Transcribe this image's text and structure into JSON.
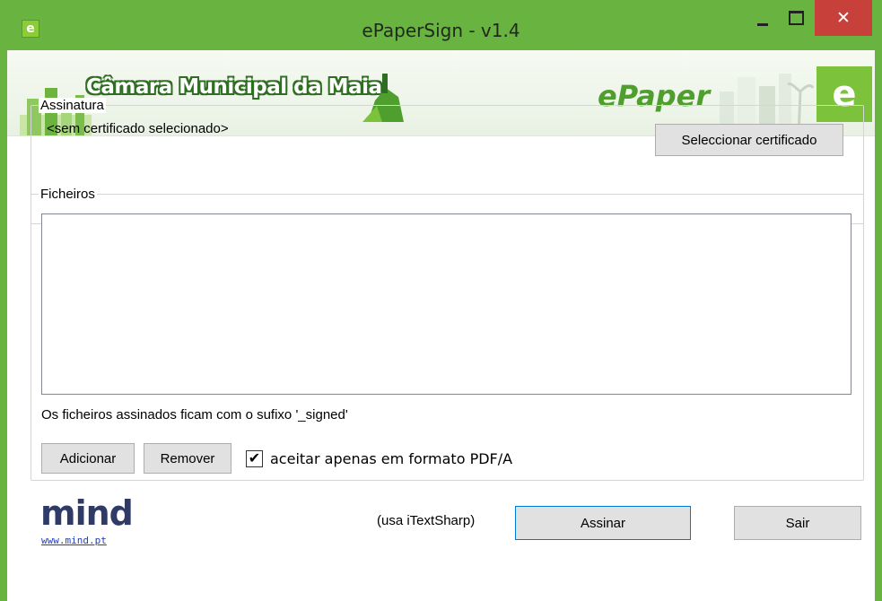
{
  "window": {
    "title": "ePaperSign - v1.4",
    "app_icon_glyph": "e",
    "controls": {
      "minimize": "minimize-icon",
      "maximize": "maximize-icon",
      "close_glyph": "✕"
    }
  },
  "banner": {
    "municipality": "Câmara Municipal da Maia",
    "product": "ePaper",
    "badge_glyph": "e"
  },
  "signature": {
    "group_label": "Assinatura",
    "certificate_status": "<sem certificado selecionado>",
    "select_button": "Seleccionar certificado"
  },
  "files": {
    "group_label": "Ficheiros",
    "items": [],
    "suffix_note": "Os ficheiros assinados ficam com o sufixo '_signed'",
    "add_button": "Adicionar",
    "remove_button": "Remover",
    "pdfa_checkbox": {
      "label": "aceitar apenas em formato PDF/A",
      "checked": true,
      "glyph": "✔"
    }
  },
  "footer": {
    "logo": "mind",
    "link": "www.mind.pt",
    "uses_note": "(usa iTextSharp)",
    "sign_button": "Assinar",
    "exit_button": "Sair"
  },
  "colors": {
    "titlebar": "#69b340",
    "close": "#c7413a",
    "accent": "#4f9f2f"
  }
}
